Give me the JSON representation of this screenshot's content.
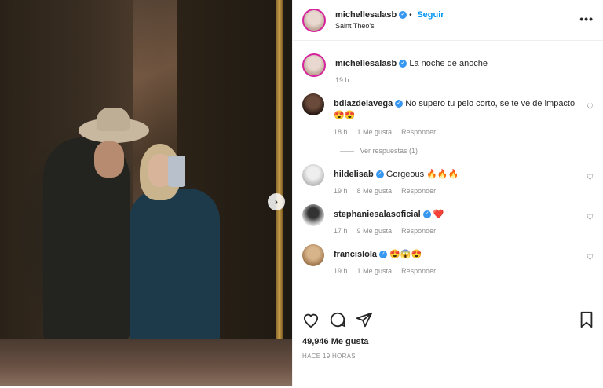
{
  "post": {
    "author": "michellesalasb",
    "follow_label": "Seguir",
    "location": "Saint Theo's",
    "more_icon": "more-dots-icon"
  },
  "caption": {
    "user": "michellesalasb",
    "text": "La noche de anoche",
    "time": "19 h"
  },
  "comments": [
    {
      "user": "bdiazdelavega",
      "text": "No supero tu pelo corto, se te ve de impacto 😍😍",
      "time": "18 h",
      "likes": "1 Me gusta",
      "reply": "Responder",
      "view_replies": "Ver respuestas (1)"
    },
    {
      "user": "hildelisab",
      "text": "Gorgeous 🔥🔥🔥",
      "time": "19 h",
      "likes": "8 Me gusta",
      "reply": "Responder"
    },
    {
      "user": "stephaniesalasoficial",
      "text": "❤️",
      "time": "17 h",
      "likes": "9 Me gusta",
      "reply": "Responder"
    },
    {
      "user": "francislola",
      "text": "😍😱😍",
      "time": "19 h",
      "likes": "1 Me gusta",
      "reply": "Responder"
    }
  ],
  "footer": {
    "likes": "49,946 Me gusta",
    "posted": "HACE 19 HORAS"
  },
  "colors": {
    "accent": "#0095f6",
    "verified": "#3897f0",
    "muted": "#8e8e8e"
  }
}
